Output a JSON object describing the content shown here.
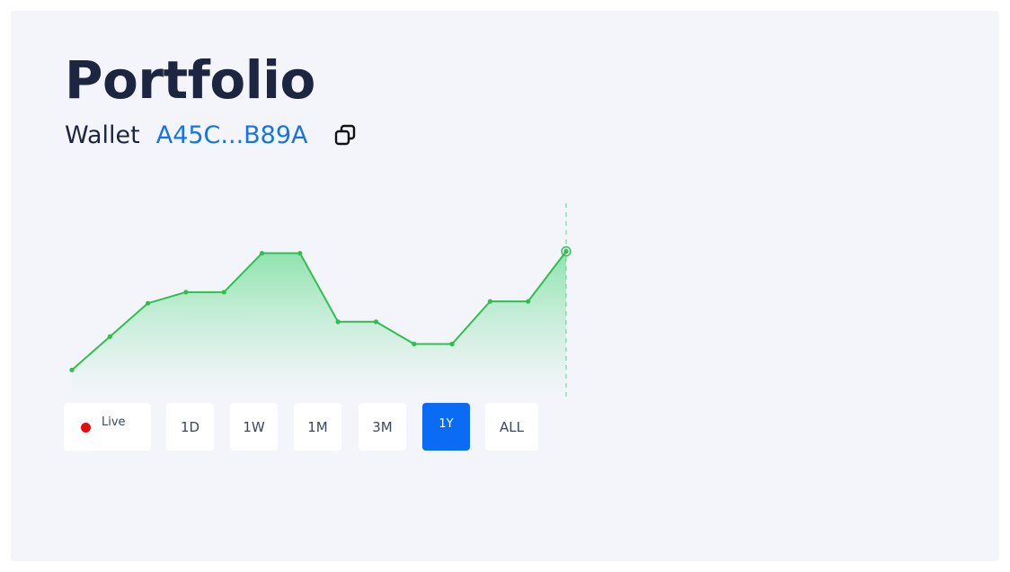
{
  "header": {
    "title": "Portfolio",
    "wallet_label": "Wallet",
    "wallet_address": "A45C...B89A",
    "copy_icon": "copy-icon"
  },
  "colors": {
    "line": "#2fbf4f",
    "fill_top": "#8ee3ad",
    "fill_bottom": "#f3f5fa",
    "active_button": "#0a6cf5",
    "live_dot": "#e80b0b",
    "address": "#1573e8"
  },
  "chart_data": {
    "type": "area",
    "title": "",
    "xlabel": "",
    "ylabel": "",
    "axes_visible": false,
    "grid": false,
    "y_unit": "relative",
    "values": [
      11,
      29,
      47,
      53,
      53,
      74,
      74,
      37,
      37,
      25,
      25,
      48,
      48,
      75
    ],
    "ylim": [
      0,
      100
    ],
    "highlight_last_point": true
  },
  "time_ranges": {
    "live_label": "Live",
    "buttons": [
      "1D",
      "1W",
      "1M",
      "3M",
      "1Y",
      "ALL"
    ],
    "selected": "1Y"
  }
}
